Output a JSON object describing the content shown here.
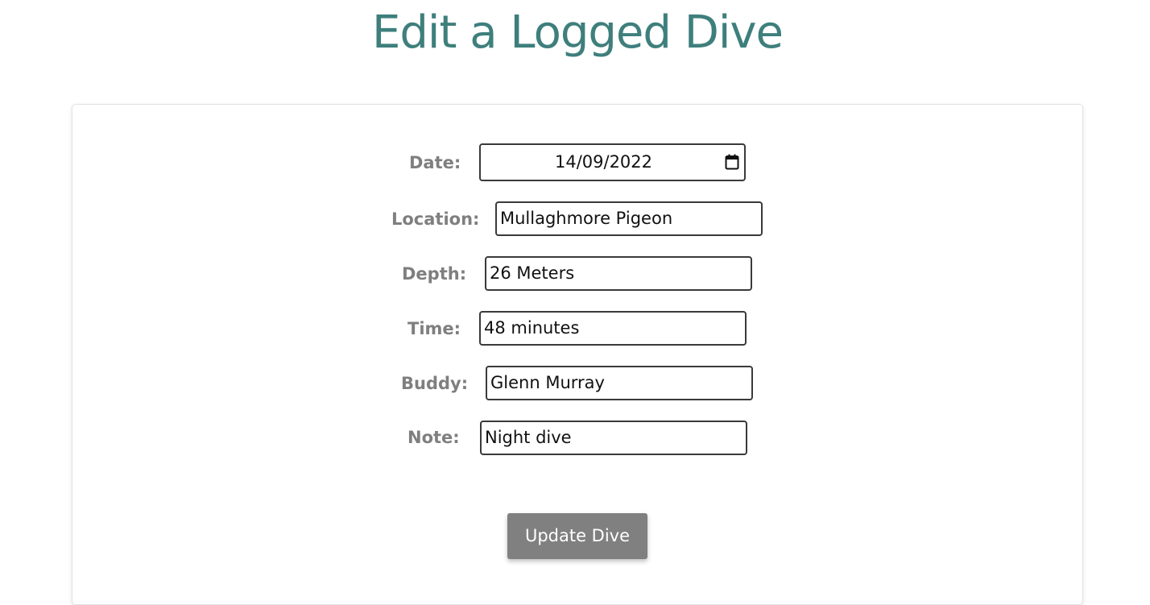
{
  "page": {
    "title": "Edit a Logged Dive"
  },
  "form": {
    "date": {
      "label": "Date:",
      "value": "14/09/2022"
    },
    "location": {
      "label": "Location:",
      "value": "Mullaghmore Pigeon"
    },
    "depth": {
      "label": "Depth:",
      "value": "26 Meters"
    },
    "time": {
      "label": "Time:",
      "value": "48 minutes"
    },
    "buddy": {
      "label": "Buddy:",
      "value": "Glenn Murray"
    },
    "note": {
      "label": "Note:",
      "value": "Night dive"
    },
    "submit_label": "Update Dive"
  },
  "icons": {
    "date_picker": "calendar-icon"
  },
  "colors": {
    "title": "#3e7f7c",
    "label": "#7f7f7f",
    "button_bg": "#808080",
    "button_text": "#ffffff"
  }
}
